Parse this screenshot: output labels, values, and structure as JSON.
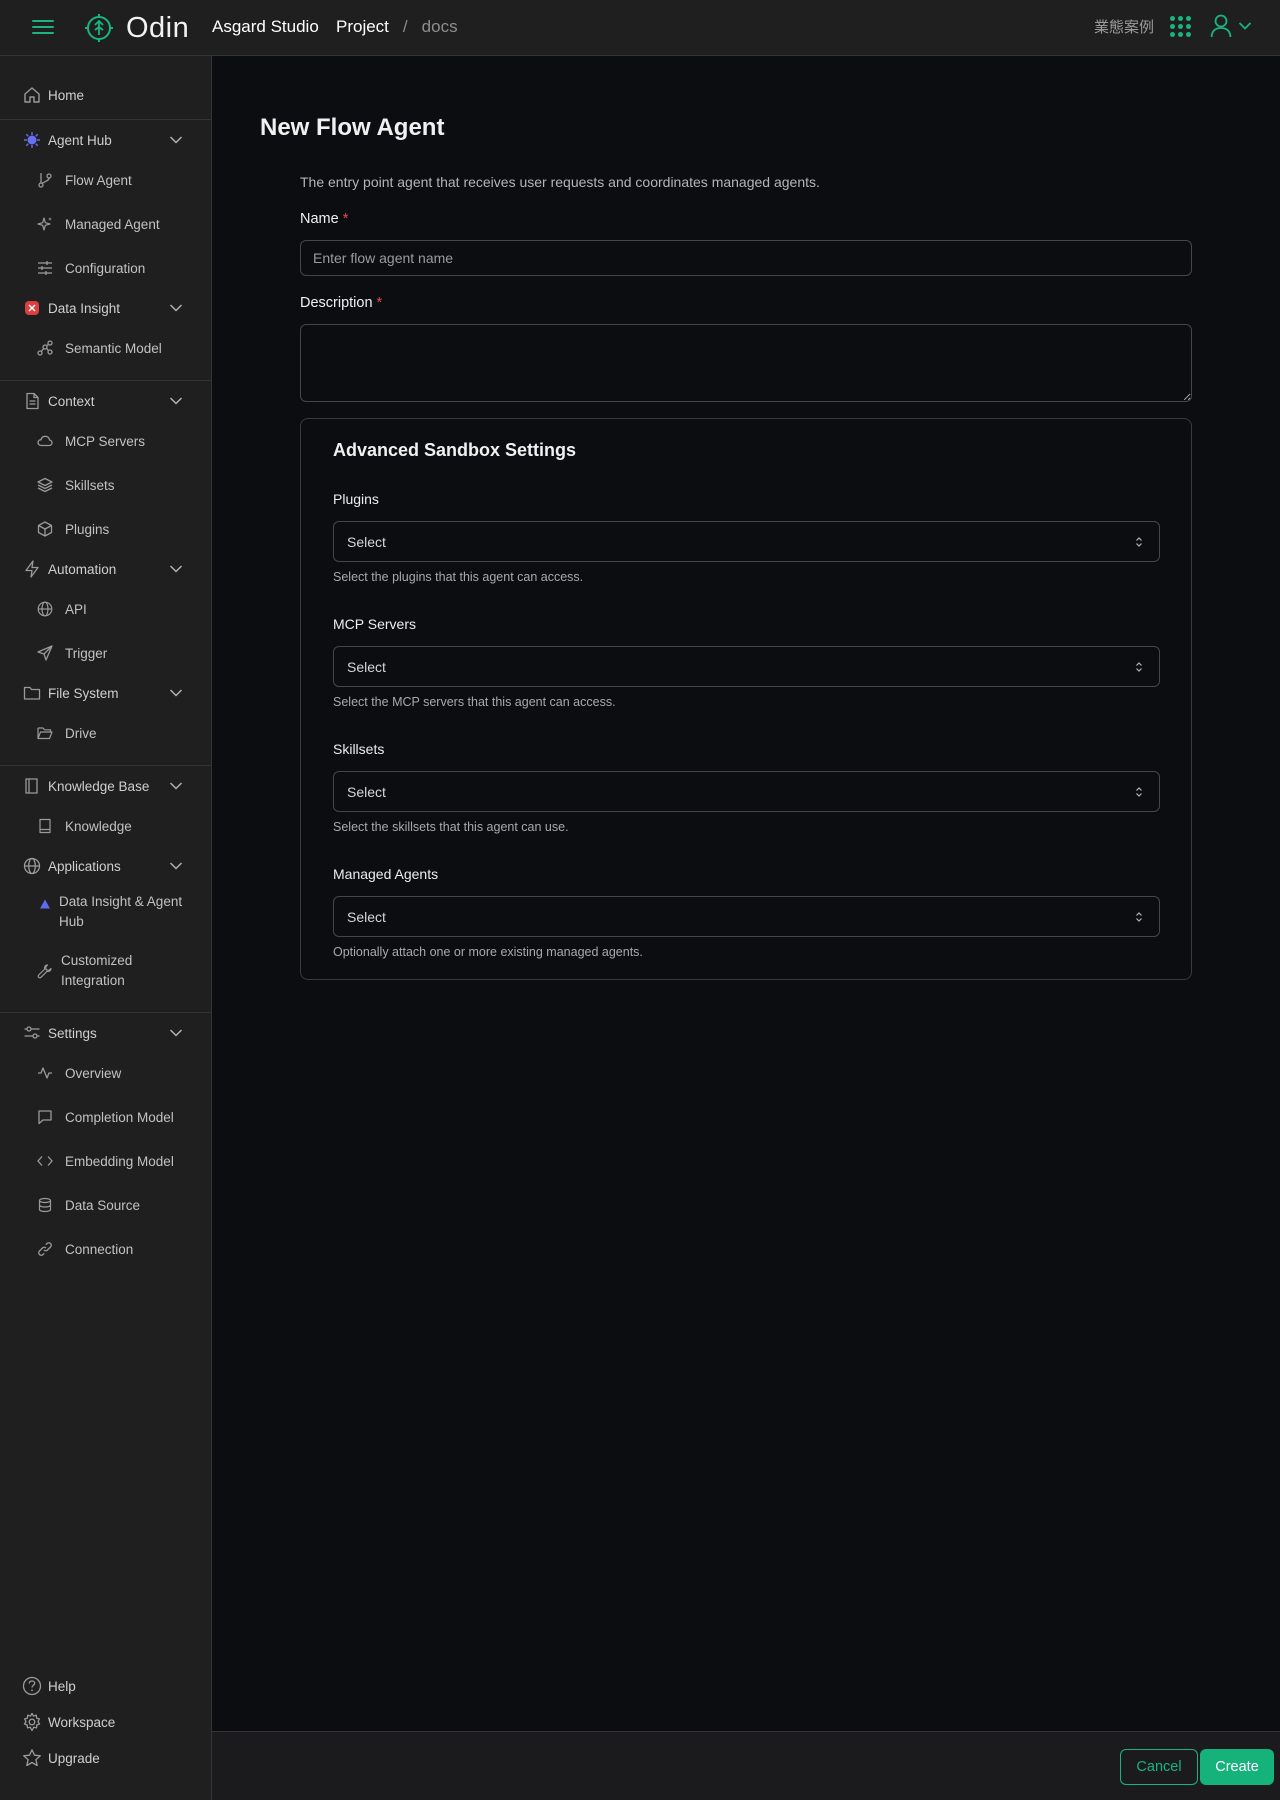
{
  "topbar": {
    "logo_text": "Odin",
    "studio": "Asgard Studio",
    "breadcrumb_project": "Project",
    "breadcrumb_separator": "/",
    "breadcrumb_current": "docs",
    "language": "業態案例"
  },
  "sidebar": {
    "home": "Home",
    "agent_hub": "Agent Hub",
    "flow_agent": "Flow Agent",
    "managed_agent": "Managed Agent",
    "configuration": "Configuration",
    "data_insight": "Data Insight",
    "semantic_model": "Semantic Model",
    "context": "Context",
    "mcp_servers": "MCP Servers",
    "skillsets": "Skillsets",
    "plugins": "Plugins",
    "automation": "Automation",
    "api": "API",
    "trigger": "Trigger",
    "file_system": "File System",
    "drive": "Drive",
    "knowledge_base": "Knowledge Base",
    "knowledge": "Knowledge",
    "applications": "Applications",
    "data_insight_agent_hub": "Data Insight & Agent Hub",
    "customized_integration": "Customized Integration",
    "settings": "Settings",
    "overview": "Overview",
    "completion_model": "Completion Model",
    "embedding_model": "Embedding Model",
    "data_source": "Data Source",
    "connection": "Connection",
    "help": "Help",
    "workspace": "Workspace",
    "upgrade": "Upgrade"
  },
  "main": {
    "title": "New Flow Agent",
    "description": "The entry point agent that receives user requests and coordinates managed agents.",
    "name_label": "Name",
    "name_placeholder": "Enter flow agent name",
    "description_label": "Description",
    "required_mark": "*",
    "sandbox": {
      "title": "Advanced Sandbox Settings",
      "plugins_label": "Plugins",
      "plugins_value": "Select",
      "plugins_help": "Select the plugins that this agent can access.",
      "mcp_label": "MCP Servers",
      "mcp_value": "Select",
      "mcp_help": "Select the MCP servers that this agent can access.",
      "skillsets_label": "Skillsets",
      "skillsets_value": "Select",
      "skillsets_help": "Select the skillsets that this agent can use.",
      "managed_label": "Managed Agents",
      "managed_value": "Select",
      "managed_help": "Optionally attach one or more existing managed agents."
    }
  },
  "footer": {
    "cancel": "Cancel",
    "create": "Create"
  },
  "colors": {
    "accent": "#19b47f",
    "required": "#e5484d",
    "background": "#0c0d11",
    "panel": "#1f1f20"
  }
}
